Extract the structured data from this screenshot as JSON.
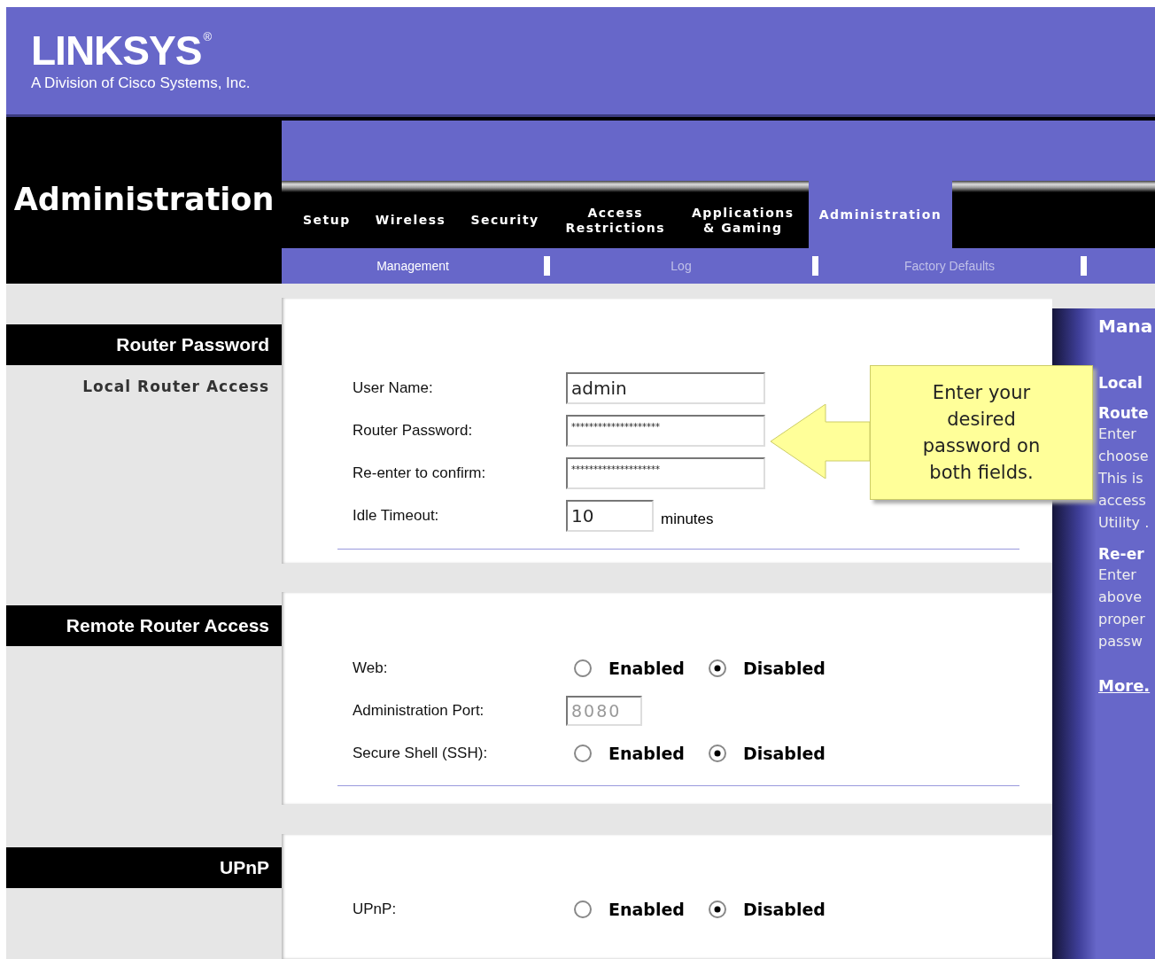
{
  "header": {
    "logo": "LINKSYS",
    "logo_mark": "®",
    "tagline": "A Division of Cisco Systems, Inc."
  },
  "page_title": "Administration",
  "tabs": [
    {
      "label": "Setup",
      "selected": false
    },
    {
      "label": "Wireless",
      "selected": false
    },
    {
      "label": "Security",
      "selected": false
    },
    {
      "label": "Access Restrictions",
      "selected": false
    },
    {
      "label": "Applications & Gaming",
      "selected": false
    },
    {
      "label": "Administration",
      "selected": true
    }
  ],
  "subtabs": [
    {
      "label": "Management",
      "selected": true
    },
    {
      "label": "Log",
      "selected": false
    },
    {
      "label": "Factory Defaults",
      "selected": false
    }
  ],
  "sections": [
    {
      "title": "Router Password",
      "subtitle": "Local Router Access",
      "fields": [
        {
          "kind": "input",
          "label": "User Name:",
          "value": "admin"
        },
        {
          "kind": "input",
          "label": "Router Password:",
          "value": "********************",
          "masked": true
        },
        {
          "kind": "input",
          "label": "Re-enter to confirm:",
          "value": "********************",
          "masked": true
        },
        {
          "kind": "input",
          "label": "Idle Timeout:",
          "value": "10",
          "unit": "minutes"
        }
      ]
    },
    {
      "title": "Remote Router Access",
      "fields": [
        {
          "kind": "radio",
          "label": "Web:",
          "options": [
            {
              "label": "Enabled",
              "selected": false
            },
            {
              "label": "Disabled",
              "selected": true
            }
          ]
        },
        {
          "kind": "input",
          "label": "Administration Port:",
          "value": "8080",
          "disabled": true
        },
        {
          "kind": "radio",
          "label": "Secure Shell (SSH):",
          "options": [
            {
              "label": "Enabled",
              "selected": false
            },
            {
              "label": "Disabled",
              "selected": true
            }
          ]
        }
      ]
    },
    {
      "title": "UPnP",
      "fields": [
        {
          "kind": "radio",
          "label": "UPnP:",
          "options": [
            {
              "label": "Enabled",
              "selected": false
            },
            {
              "label": "Disabled",
              "selected": true
            }
          ]
        }
      ]
    }
  ],
  "callout": "Enter your desired password on both fields.",
  "help": [
    {
      "kind": "title",
      "text": "Mana"
    },
    {
      "kind": "heading",
      "text": "Local"
    },
    {
      "kind": "heading",
      "text": "Route"
    },
    {
      "kind": "text",
      "text": "Enter"
    },
    {
      "kind": "text",
      "text": "choose"
    },
    {
      "kind": "text",
      "text": "This is"
    },
    {
      "kind": "text",
      "text": "access"
    },
    {
      "kind": "text",
      "text": "Utility ."
    },
    {
      "kind": "heading",
      "text": "Re-er"
    },
    {
      "kind": "text",
      "text": "Enter"
    },
    {
      "kind": "text",
      "text": "above"
    },
    {
      "kind": "text",
      "text": "proper"
    },
    {
      "kind": "text",
      "text": "passw"
    },
    {
      "kind": "link",
      "text": "More."
    }
  ]
}
